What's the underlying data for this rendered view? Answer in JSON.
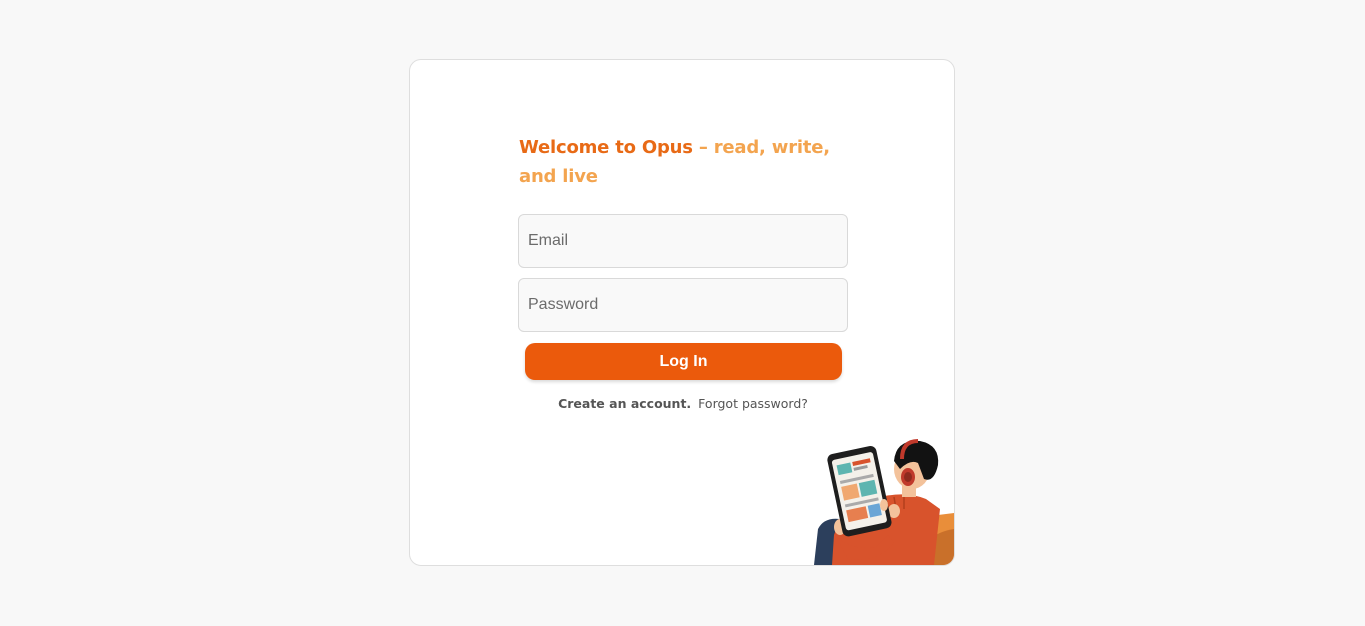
{
  "login": {
    "heading_brand": "Welcome to Opus",
    "heading_tagline": " – read, write, and live",
    "email_placeholder": "Email",
    "password_placeholder": "Password",
    "login_label": "Log In",
    "create_account_label": "Create an account.",
    "forgot_password_label": "Forgot password?"
  },
  "colors": {
    "accent": "#eb5a0c",
    "brand_text": "#e86a16",
    "tagline_text": "#f3a44f",
    "background": "#f8f8f8"
  },
  "icons": {
    "illustration": "person-reading-tablet-illustration"
  }
}
